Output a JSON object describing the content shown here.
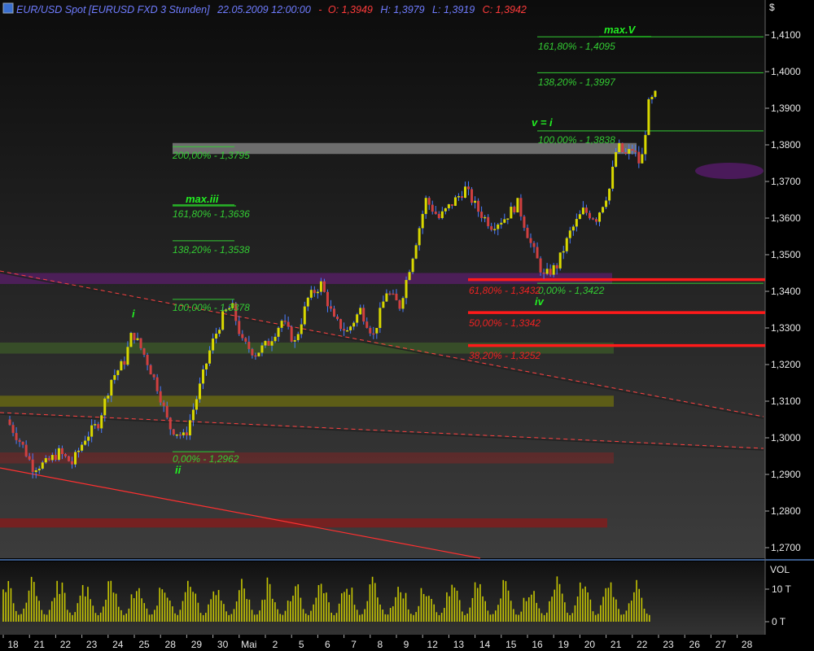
{
  "header": {
    "instrument": "EUR/USD Spot [EURUSD FXD  3 Stunden]",
    "datetime": "22.05.2009 12:00:00",
    "open_label": "O:",
    "open": "1,3949",
    "high_label": "H:",
    "high": "1,3979",
    "low_label": "L:",
    "low": "1,3919",
    "close_label": "C:",
    "close": "1,3942"
  },
  "colors": {
    "background_top": "#0c0c0c",
    "background_bottom": "#3a3a3a",
    "candle_up": "#d8d800",
    "candle_down": "#d04040",
    "wick": "#4a7cff",
    "fib_green": "#33cc33",
    "fib_red": "#ff1a1a",
    "volume": "#d8d800"
  },
  "chart_data": {
    "type": "candlestick",
    "price_unit": "$",
    "volume_label": "VOL",
    "ylim": [
      1.265,
      1.415
    ],
    "y_ticks": [
      "1,2700",
      "1,2800",
      "1,2900",
      "1,3000",
      "1,3100",
      "1,3200",
      "1,3300",
      "1,3400",
      "1,3500",
      "1,3600",
      "1,3700",
      "1,3800",
      "1,3900",
      "1,4000",
      "1,4100"
    ],
    "volume_ticks": [
      "10 T",
      "0 T"
    ],
    "x_ticks": [
      "18",
      "21",
      "22",
      "23",
      "24",
      "25",
      "28",
      "29",
      "30",
      "Mai",
      "2",
      "5",
      "6",
      "7",
      "8",
      "9",
      "12",
      "13",
      "14",
      "15",
      "16",
      "19",
      "20",
      "21",
      "22",
      "23",
      "26",
      "27",
      "28"
    ],
    "price_path": [
      {
        "d": 0,
        "p": 1.305
      },
      {
        "d": 0.6,
        "p": 1.298
      },
      {
        "d": 1.0,
        "p": 1.292
      },
      {
        "d": 1.5,
        "p": 1.293
      },
      {
        "d": 2.0,
        "p": 1.296
      },
      {
        "d": 2.5,
        "p": 1.293
      },
      {
        "d": 3.0,
        "p": 1.3
      },
      {
        "d": 3.5,
        "p": 1.304
      },
      {
        "d": 4.0,
        "p": 1.316
      },
      {
        "d": 4.5,
        "p": 1.321
      },
      {
        "d": 4.8,
        "p": 1.329
      },
      {
        "d": 5.3,
        "p": 1.322
      },
      {
        "d": 5.8,
        "p": 1.313
      },
      {
        "d": 6.2,
        "p": 1.303
      },
      {
        "d": 6.8,
        "p": 1.3
      },
      {
        "d": 7.3,
        "p": 1.312
      },
      {
        "d": 7.8,
        "p": 1.325
      },
      {
        "d": 8.3,
        "p": 1.334
      },
      {
        "d": 8.6,
        "p": 1.336
      },
      {
        "d": 9.0,
        "p": 1.326
      },
      {
        "d": 9.5,
        "p": 1.323
      },
      {
        "d": 10.0,
        "p": 1.326
      },
      {
        "d": 10.5,
        "p": 1.332
      },
      {
        "d": 11.0,
        "p": 1.326
      },
      {
        "d": 11.5,
        "p": 1.338
      },
      {
        "d": 12.0,
        "p": 1.342
      },
      {
        "d": 12.5,
        "p": 1.332
      },
      {
        "d": 13.0,
        "p": 1.329
      },
      {
        "d": 13.5,
        "p": 1.335
      },
      {
        "d": 14.0,
        "p": 1.328
      },
      {
        "d": 14.5,
        "p": 1.34
      },
      {
        "d": 15.0,
        "p": 1.336
      },
      {
        "d": 15.5,
        "p": 1.35
      },
      {
        "d": 16.0,
        "p": 1.365
      },
      {
        "d": 16.5,
        "p": 1.36
      },
      {
        "d": 17.0,
        "p": 1.364
      },
      {
        "d": 17.5,
        "p": 1.368
      },
      {
        "d": 18.0,
        "p": 1.362
      },
      {
        "d": 18.5,
        "p": 1.358
      },
      {
        "d": 19.0,
        "p": 1.36
      },
      {
        "d": 19.5,
        "p": 1.364
      },
      {
        "d": 20.0,
        "p": 1.353
      },
      {
        "d": 20.5,
        "p": 1.344
      },
      {
        "d": 21.0,
        "p": 1.347
      },
      {
        "d": 21.5,
        "p": 1.356
      },
      {
        "d": 22.0,
        "p": 1.362
      },
      {
        "d": 22.5,
        "p": 1.36
      },
      {
        "d": 23.0,
        "p": 1.368
      },
      {
        "d": 23.3,
        "p": 1.38
      },
      {
        "d": 23.6,
        "p": 1.377
      },
      {
        "d": 23.9,
        "p": 1.379
      },
      {
        "d": 24.2,
        "p": 1.374
      },
      {
        "d": 24.5,
        "p": 1.391
      },
      {
        "d": 24.8,
        "p": 1.394
      }
    ],
    "fib_levels": [
      {
        "label": "161,80% - 1,4095",
        "price": 1.4095,
        "color": "green"
      },
      {
        "label": "138,20% - 1,3997",
        "price": 1.3997,
        "color": "green"
      },
      {
        "label": "100,00% - 1,3838",
        "price": 1.3838,
        "color": "green"
      },
      {
        "label": "0,00% - 1,3422",
        "price": 1.3422,
        "color": "green"
      },
      {
        "label": "200,00% - 1,3795",
        "price": 1.3795,
        "color": "green"
      },
      {
        "label": "161,80% - 1,3636",
        "price": 1.3636,
        "color": "green"
      },
      {
        "label": "138,20% - 1,3538",
        "price": 1.3538,
        "color": "green"
      },
      {
        "label": "100,00% - 1,3378",
        "price": 1.3378,
        "color": "green"
      },
      {
        "label": "0,00% - 1,2962",
        "price": 1.2962,
        "color": "green"
      },
      {
        "label": "61,80% - 1,3432",
        "price": 1.3432,
        "color": "red"
      },
      {
        "label": "50,00% - 1,3342",
        "price": 1.3342,
        "color": "red"
      },
      {
        "label": "38,20% - 1,3252",
        "price": 1.3252,
        "color": "red"
      }
    ],
    "wave_labels": [
      "max.V",
      "v = i",
      "max.iii",
      "i",
      "ii",
      "iv"
    ],
    "zones": [
      {
        "name": "gray",
        "price_top": 1.3805,
        "price_bottom": 1.3775,
        "color": "#8a8a8a"
      },
      {
        "name": "purple",
        "price_top": 1.345,
        "price_bottom": 1.342,
        "color": "#5a1e6a"
      },
      {
        "name": "green",
        "price_top": 1.326,
        "price_bottom": 1.323,
        "color": "#3c5a28"
      },
      {
        "name": "olive",
        "price_top": 1.3115,
        "price_bottom": 1.3085,
        "color": "#6e6e10"
      },
      {
        "name": "maroon",
        "price_top": 1.296,
        "price_bottom": 1.293,
        "color": "#6a2a2a"
      },
      {
        "name": "red",
        "price_top": 1.278,
        "price_bottom": 1.2755,
        "color": "#8a1a1a"
      }
    ]
  }
}
